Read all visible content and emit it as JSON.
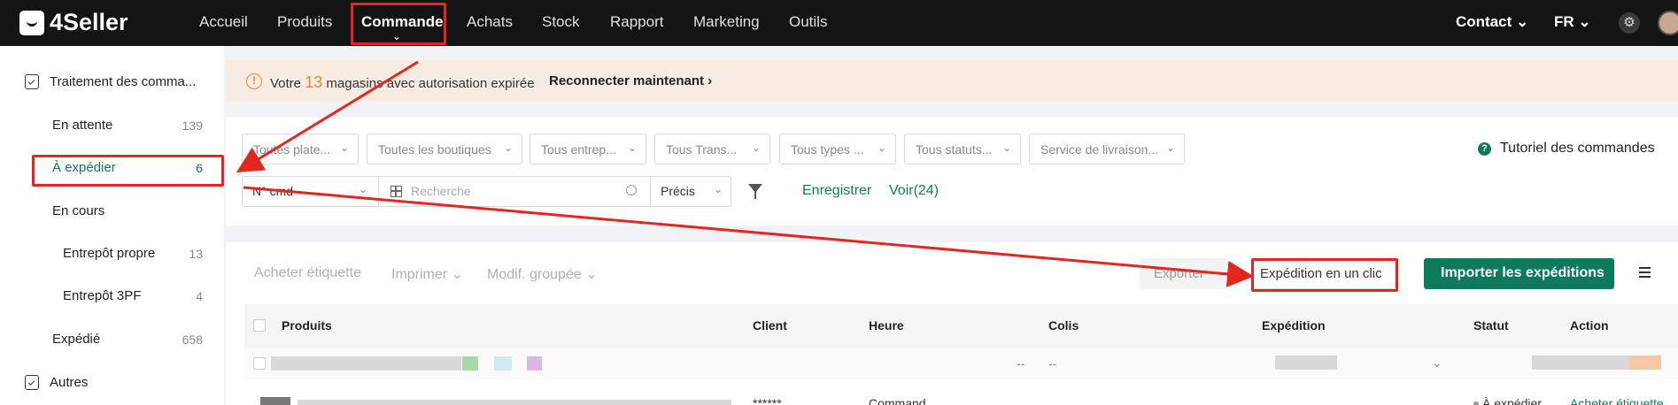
{
  "app": {
    "name": "4Seller"
  },
  "nav": {
    "items": [
      "Accueil",
      "Produits",
      "Commande",
      "Achats",
      "Stock",
      "Rapport",
      "Marketing",
      "Outils"
    ],
    "active": "Commande",
    "contact": "Contact",
    "language": "FR"
  },
  "sidebar": {
    "section_title": "Traitement des comma...",
    "items": [
      {
        "label": "En attente",
        "count": "139"
      },
      {
        "label": "À expédier",
        "count": "6"
      },
      {
        "label": "En cours",
        "count": ""
      },
      {
        "label": "Entrepôt propre",
        "count": "13"
      },
      {
        "label": "Entrepôt 3PF",
        "count": "4"
      },
      {
        "label": "Expédié",
        "count": "658"
      }
    ],
    "other_section": "Autres"
  },
  "banner": {
    "text_before": "Votre",
    "count": "13",
    "text_after": "magasins avec autorisation expirée",
    "link": "Reconnecter maintenant"
  },
  "filters": {
    "dropdowns": [
      "Toutes plate...",
      "Toutes les boutiques",
      "Tous entrep...",
      "Tous Trans...",
      "Tous types ...",
      "Tous statuts...",
      "Service de livraison..."
    ],
    "tutorial": "Tutoriel des commandes",
    "search_field": "N° cmd",
    "search_placeholder": "Recherche",
    "match_mode": "Précis",
    "save_link": "Enregistrer",
    "view_link": "Voir(24)"
  },
  "toolbar": {
    "buy_label": "Acheter étiquette",
    "print_label": "Imprimer",
    "bulk_edit_label": "Modif. groupée",
    "export_label": "Exporter",
    "one_click_label": "Expédition en un clic",
    "import_label": "Importer les expéditions"
  },
  "table": {
    "headers": [
      "Produits",
      "Client",
      "Heure",
      "Colis",
      "Expédition",
      "Statut",
      "Action"
    ],
    "row1": {
      "dash_a": "--",
      "dash_b": "--"
    },
    "row2": {
      "client": "******",
      "time": "Command",
      "status": "À expédier",
      "action": "Acheter étiquette"
    }
  },
  "colors": {
    "accent": "#0f7a5b",
    "topbar": "#141414",
    "annotation": "#e5251f",
    "warning": "#e58a2f"
  }
}
